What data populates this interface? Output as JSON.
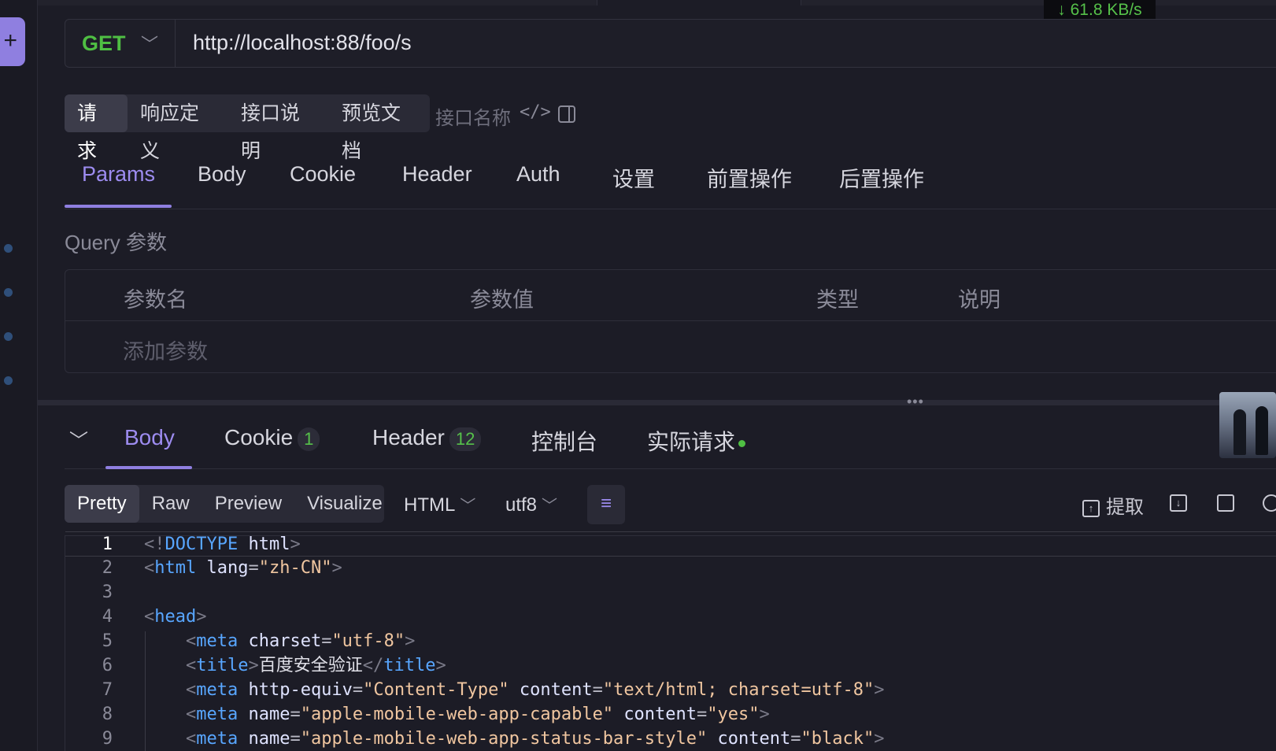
{
  "network": {
    "speed": "↓ 61.8 KB/s"
  },
  "rail": {
    "add_label": "+"
  },
  "request": {
    "method": "GET",
    "url": "http://localhost:88/foo/s"
  },
  "mode_tabs": {
    "items": [
      "请求",
      "响应定义",
      "接口说明",
      "预览文档"
    ],
    "active": "请求",
    "name_placeholder": "接口名称",
    "code_label": "</>"
  },
  "request_tabs": {
    "items": [
      "Params",
      "Body",
      "Cookie",
      "Header",
      "Auth",
      "设置",
      "前置操作",
      "后置操作"
    ],
    "active": "Params"
  },
  "query": {
    "title": "Query 参数",
    "columns": [
      "参数名",
      "参数值",
      "类型",
      "说明"
    ],
    "add_label": "添加参数"
  },
  "splitter": {
    "dots": "•••"
  },
  "response_tabs": {
    "items": [
      {
        "label": "Body",
        "badge": ""
      },
      {
        "label": "Cookie",
        "badge": "1"
      },
      {
        "label": "Header",
        "badge": "12"
      },
      {
        "label": "控制台",
        "badge": ""
      },
      {
        "label": "实际请求",
        "badge": ""
      }
    ],
    "active": "Body"
  },
  "viewer": {
    "modes": [
      "Pretty",
      "Raw",
      "Preview",
      "Visualize"
    ],
    "active": "Pretty",
    "format": "HTML",
    "encoding": "utf8",
    "extract_label": "提取"
  },
  "code_lines": [
    {
      "n": "1",
      "parts": [
        [
          "bk",
          "<!"
        ],
        [
          "tg",
          "DOCTYPE"
        ],
        [
          "tx",
          " "
        ],
        [
          "at",
          "html"
        ],
        [
          "bk",
          ">"
        ]
      ]
    },
    {
      "n": "2",
      "parts": [
        [
          "bk",
          "<"
        ],
        [
          "tg",
          "html"
        ],
        [
          "tx",
          " "
        ],
        [
          "at",
          "lang"
        ],
        [
          "eq",
          "="
        ],
        [
          "st",
          "\"zh-CN\""
        ],
        [
          "bk",
          ">"
        ]
      ]
    },
    {
      "n": "3",
      "parts": []
    },
    {
      "n": "4",
      "parts": [
        [
          "bk",
          "<"
        ],
        [
          "tg",
          "head"
        ],
        [
          "bk",
          ">"
        ]
      ]
    },
    {
      "n": "5",
      "parts": [
        [
          "tx",
          "    "
        ],
        [
          "bk",
          "<"
        ],
        [
          "tg",
          "meta"
        ],
        [
          "tx",
          " "
        ],
        [
          "at",
          "charset"
        ],
        [
          "eq",
          "="
        ],
        [
          "st",
          "\"utf-8\""
        ],
        [
          "bk",
          ">"
        ]
      ]
    },
    {
      "n": "6",
      "parts": [
        [
          "tx",
          "    "
        ],
        [
          "bk",
          "<"
        ],
        [
          "tg",
          "title"
        ],
        [
          "bk",
          ">"
        ],
        [
          "tx",
          "百度安全验证"
        ],
        [
          "bk",
          "</"
        ],
        [
          "tg",
          "title"
        ],
        [
          "bk",
          ">"
        ]
      ]
    },
    {
      "n": "7",
      "parts": [
        [
          "tx",
          "    "
        ],
        [
          "bk",
          "<"
        ],
        [
          "tg",
          "meta"
        ],
        [
          "tx",
          " "
        ],
        [
          "at",
          "http-equiv"
        ],
        [
          "eq",
          "="
        ],
        [
          "st",
          "\"Content-Type\""
        ],
        [
          "tx",
          " "
        ],
        [
          "at",
          "content"
        ],
        [
          "eq",
          "="
        ],
        [
          "st",
          "\"text/html; charset=utf-8\""
        ],
        [
          "bk",
          ">"
        ]
      ]
    },
    {
      "n": "8",
      "parts": [
        [
          "tx",
          "    "
        ],
        [
          "bk",
          "<"
        ],
        [
          "tg",
          "meta"
        ],
        [
          "tx",
          " "
        ],
        [
          "at",
          "name"
        ],
        [
          "eq",
          "="
        ],
        [
          "st",
          "\"apple-mobile-web-app-capable\""
        ],
        [
          "tx",
          " "
        ],
        [
          "at",
          "content"
        ],
        [
          "eq",
          "="
        ],
        [
          "st",
          "\"yes\""
        ],
        [
          "bk",
          ">"
        ]
      ]
    },
    {
      "n": "9",
      "parts": [
        [
          "tx",
          "    "
        ],
        [
          "bk",
          "<"
        ],
        [
          "tg",
          "meta"
        ],
        [
          "tx",
          " "
        ],
        [
          "at",
          "name"
        ],
        [
          "eq",
          "="
        ],
        [
          "st",
          "\"apple-mobile-web-app-status-bar-style\""
        ],
        [
          "tx",
          " "
        ],
        [
          "at",
          "content"
        ],
        [
          "eq",
          "="
        ],
        [
          "st",
          "\"black\""
        ],
        [
          "bk",
          ">"
        ]
      ]
    }
  ]
}
